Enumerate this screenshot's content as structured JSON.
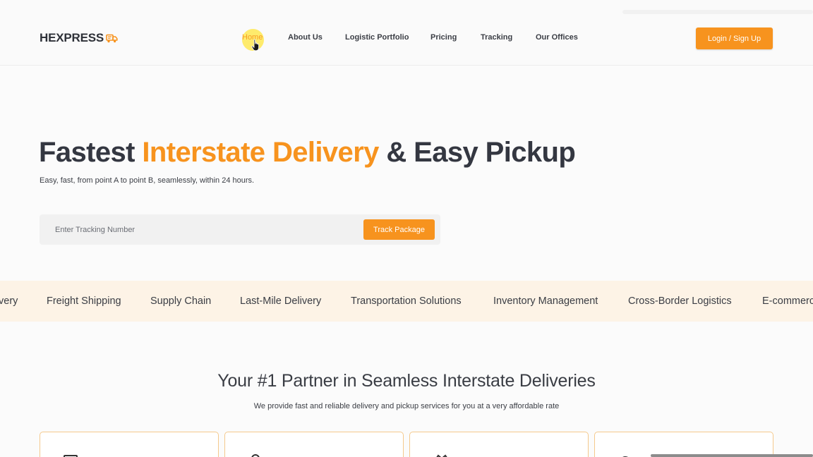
{
  "brand": {
    "name": "HEXPRESS",
    "logo_icon": "delivery-truck-icon"
  },
  "nav": {
    "items": [
      {
        "label": "Home",
        "active": true
      },
      {
        "label": "About Us"
      },
      {
        "label": "Logistic Portfolio"
      },
      {
        "label": "Pricing"
      },
      {
        "label": "Tracking"
      },
      {
        "label": "Our Offices"
      }
    ],
    "login_label": "Login / Sign Up"
  },
  "hero": {
    "title_part1": "Fastest ",
    "title_accent": "Interstate Delivery",
    "title_part2": " & Easy Pickup",
    "subtitle": "Easy, fast, from point A to point B, seamlessly, within 24 hours.",
    "tracking_placeholder": "Enter Tracking Number",
    "track_button": "Track Package"
  },
  "services_marquee": [
    "very",
    "Freight Shipping",
    "Supply Chain",
    "Last-Mile Delivery",
    "Transportation Solutions",
    "Inventory Management",
    "Cross-Border Logistics",
    "E-commerc"
  ],
  "section": {
    "title": "Your #1 Partner in Seamless Interstate Deliveries",
    "subtitle": "We provide fast and reliable delivery and pickup services for you at a very affordable rate"
  },
  "cards": [
    {
      "icon": "calendar-icon"
    },
    {
      "icon": "location-pin-icon"
    },
    {
      "icon": "handshake-icon"
    },
    {
      "icon": "support-icon"
    }
  ],
  "colors": {
    "accent": "#f7931e",
    "text_dark": "#343741",
    "marquee_bg": "#fdf3e6",
    "card_border": "#f5c98c"
  }
}
